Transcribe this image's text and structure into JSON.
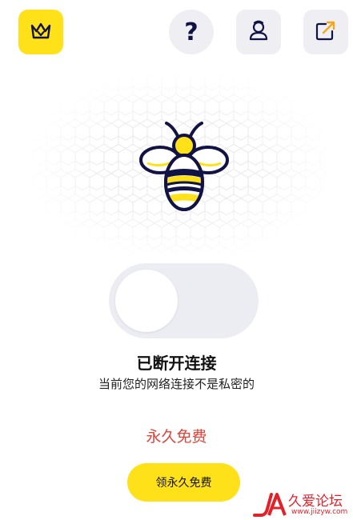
{
  "header": {
    "buttons": [
      {
        "name": "premium",
        "icon": "crown-icon",
        "bg": "#ffe11a"
      },
      {
        "name": "help",
        "icon": "help-icon",
        "glyph": "?",
        "bg": "#eeeef3"
      },
      {
        "name": "account",
        "icon": "user-icon",
        "bg": "#eeeef3"
      },
      {
        "name": "share",
        "icon": "share-icon",
        "bg": "#eeeef3"
      }
    ]
  },
  "hero": {
    "icon": "bee-icon",
    "colors": {
      "outline": "#111344",
      "accent": "#ffe11a"
    }
  },
  "connection": {
    "toggle_on": false,
    "status_title": "已断开连接",
    "status_description": "当前您的网络连接不是私密的"
  },
  "promo": {
    "free_text": "永久免费",
    "button_label": "领永久免费"
  },
  "watermark": {
    "logo_icon": "ja-logo-icon",
    "title": "久爱论坛",
    "url": "www.jiizyw.com"
  },
  "colors": {
    "accent": "#ffe11a",
    "warning": "#e0433a",
    "dark": "#111344"
  }
}
